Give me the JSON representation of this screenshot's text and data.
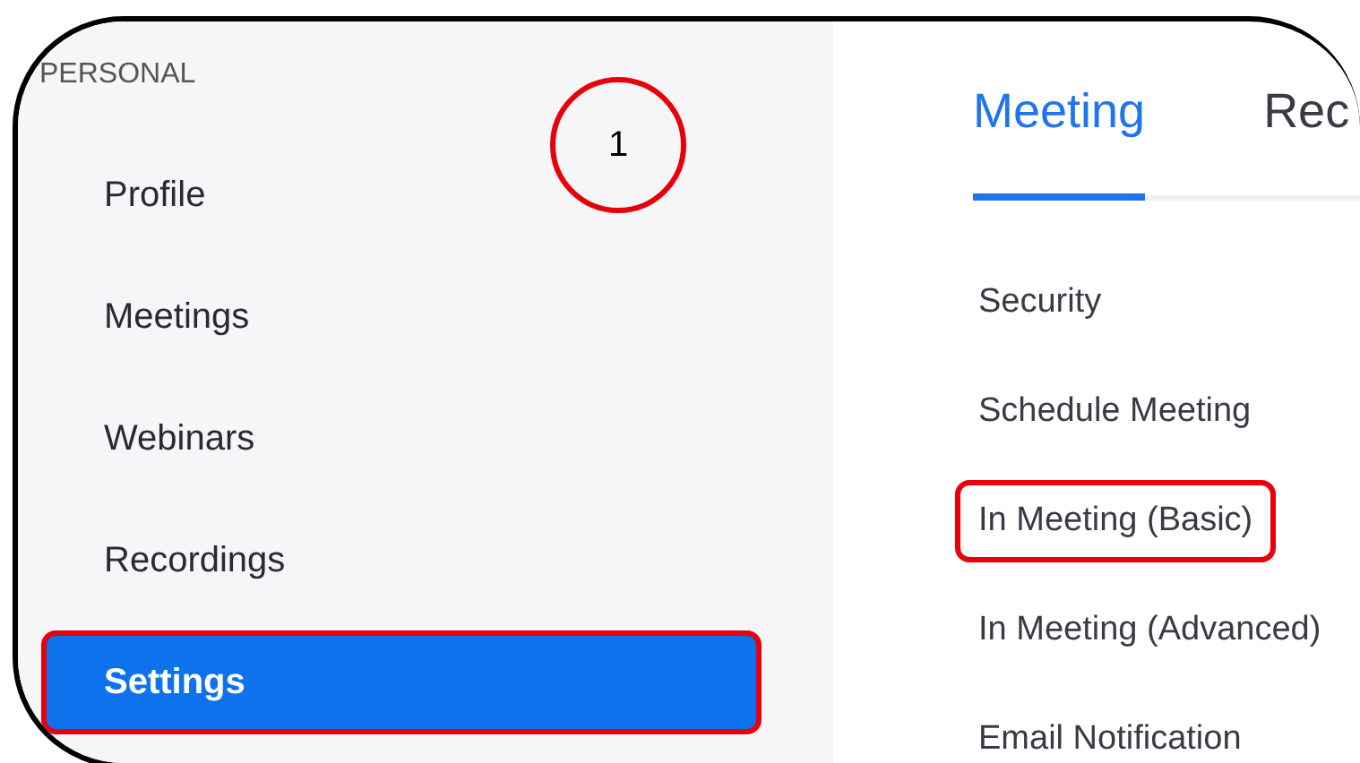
{
  "sidebar": {
    "section": "PERSONAL",
    "items": [
      {
        "label": "Profile",
        "selected": false,
        "highlighted": false
      },
      {
        "label": "Meetings",
        "selected": false,
        "highlighted": false
      },
      {
        "label": "Webinars",
        "selected": false,
        "highlighted": false
      },
      {
        "label": "Recordings",
        "selected": false,
        "highlighted": false
      },
      {
        "label": "Settings",
        "selected": true,
        "highlighted": true
      }
    ]
  },
  "step_marker": {
    "label": "1"
  },
  "tabs": [
    {
      "label": "Meeting",
      "selected": true
    },
    {
      "label": "Rec",
      "selected": false
    }
  ],
  "sections": [
    {
      "label": "Security",
      "highlighted": false
    },
    {
      "label": "Schedule Meeting",
      "highlighted": false
    },
    {
      "label": "In Meeting (Basic)",
      "highlighted": true
    },
    {
      "label": "In Meeting (Advanced)",
      "highlighted": false
    },
    {
      "label": "Email Notification",
      "highlighted": false
    }
  ]
}
